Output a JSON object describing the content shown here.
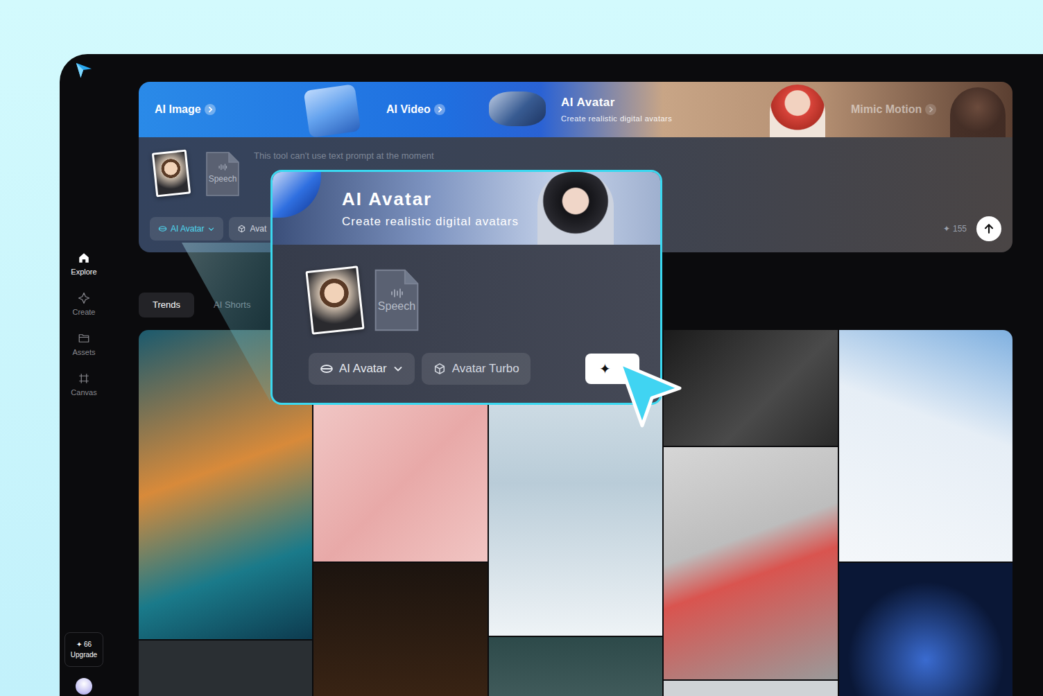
{
  "sidebar": {
    "items": [
      {
        "label": "Explore",
        "selected": true
      },
      {
        "label": "Create",
        "selected": false
      },
      {
        "label": "Assets",
        "selected": false
      },
      {
        "label": "Canvas",
        "selected": false
      }
    ],
    "credits_icon": "✦",
    "credits": "66",
    "upgrade": "Upgrade"
  },
  "tools": [
    {
      "label": "AI Image",
      "selected": false,
      "faded": false
    },
    {
      "label": "AI Video",
      "selected": false,
      "faded": false
    },
    {
      "label": "AI Avatar",
      "subtitle": "Create realistic digital avatars",
      "selected": true,
      "faded": false
    },
    {
      "label": "Mimic Motion",
      "selected": false,
      "faded": true
    }
  ],
  "prompt": {
    "placeholder": "This tool can't use text prompt at the moment",
    "attachments": [
      {
        "kind": "image"
      },
      {
        "kind": "audio",
        "label": "Speech"
      }
    ],
    "chips": [
      {
        "label": "AI Avatar",
        "kind": "mode",
        "dropdown": true
      },
      {
        "label": "Avat",
        "kind": "model",
        "dropdown": false
      }
    ],
    "credits_icon": "✦",
    "credits": "155"
  },
  "feed_tabs": [
    {
      "label": "Trends",
      "selected": true
    },
    {
      "label": "AI Shorts",
      "selected": false
    }
  ],
  "zoom": {
    "title": "AI Avatar",
    "subtitle": "Create realistic digital avatars",
    "attachments": [
      {
        "kind": "image"
      },
      {
        "kind": "audio",
        "label": "Speech"
      }
    ],
    "chips": [
      {
        "label": "AI Avatar",
        "kind": "mode",
        "dropdown": true
      },
      {
        "label": "Avatar Turbo",
        "kind": "model",
        "dropdown": false
      }
    ],
    "generate_icon": "✦"
  }
}
